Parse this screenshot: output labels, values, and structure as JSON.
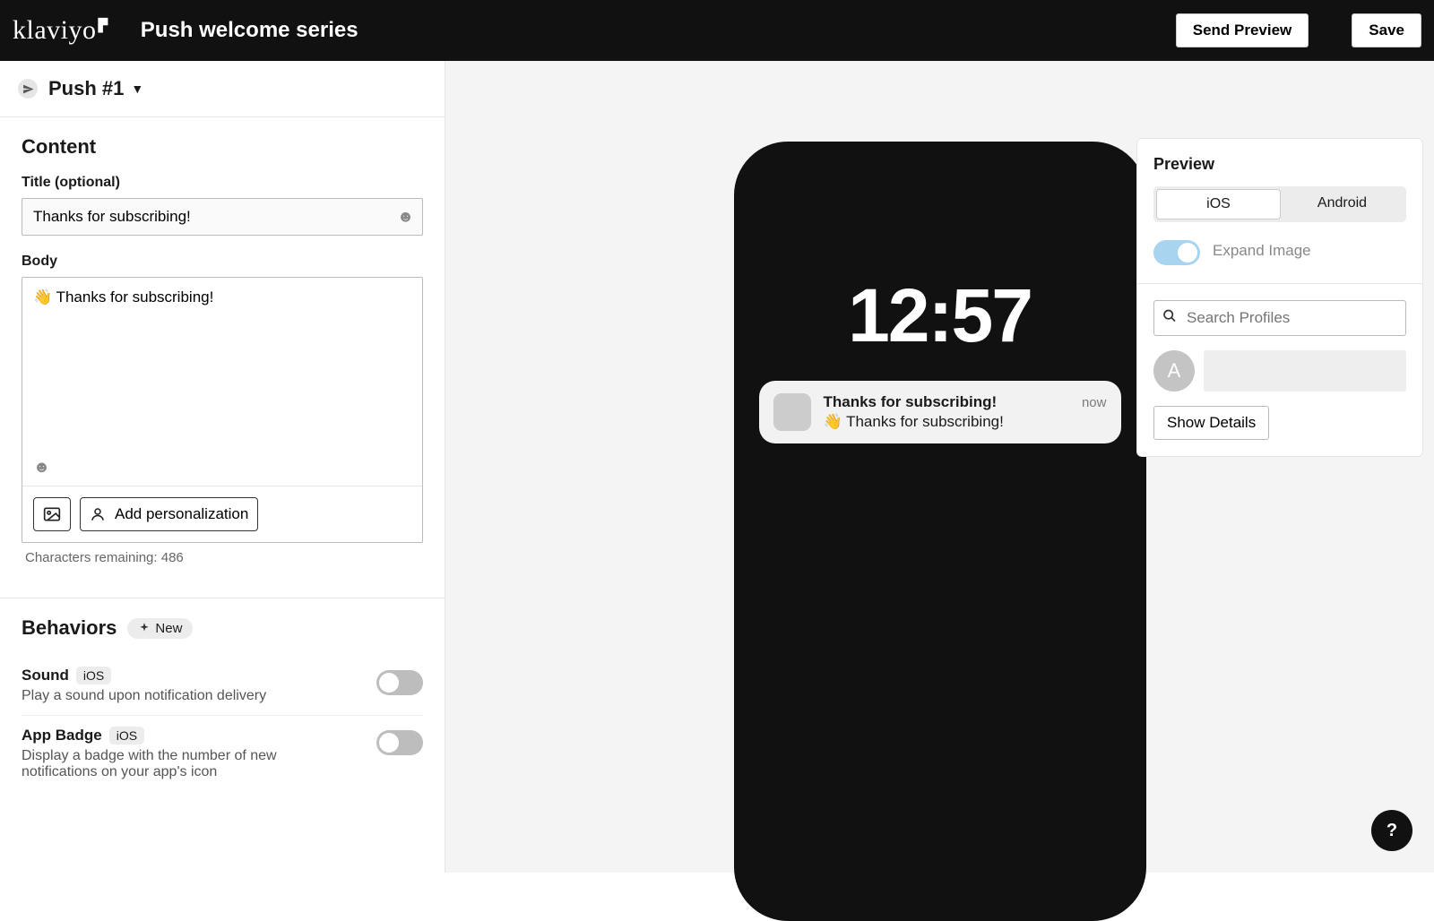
{
  "header": {
    "logo": "klaviyo",
    "flow_title": "Push welcome series",
    "send_preview": "Send Preview",
    "save": "Save"
  },
  "push": {
    "name": "Push #1"
  },
  "content": {
    "heading": "Content",
    "title_label": "Title (optional)",
    "title_value": "Thanks for subscribing!",
    "body_label": "Body",
    "body_value": "👋 Thanks for subscribing!",
    "add_personalization": "Add personalization",
    "char_count": "Characters remaining: 486"
  },
  "behaviors": {
    "heading": "Behaviors",
    "new_badge": "New",
    "sound": {
      "title": "Sound",
      "platform": "iOS",
      "desc": "Play a sound upon notification delivery",
      "enabled": false
    },
    "app_badge": {
      "title": "App Badge",
      "platform": "iOS",
      "desc": "Display a badge with the number of new notifications on your app's icon",
      "enabled": false
    }
  },
  "phone": {
    "time": "12:57",
    "notification": {
      "title": "Thanks for subscribing!",
      "time": "now",
      "body": "👋 Thanks for subscribing!"
    }
  },
  "preview": {
    "heading": "Preview",
    "tabs": {
      "ios": "iOS",
      "android": "Android",
      "active": "ios"
    },
    "expand_image": {
      "label": "Expand Image",
      "enabled": true
    },
    "search_placeholder": "Search Profiles",
    "avatar_letter": "A",
    "show_details": "Show Details"
  },
  "help": "?"
}
